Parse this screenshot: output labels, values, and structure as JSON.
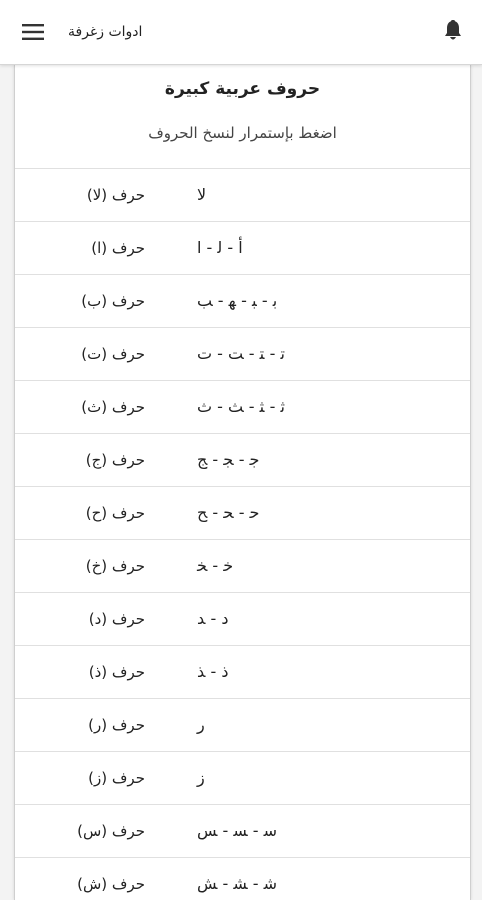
{
  "appbar": {
    "title": "ادوات زغرفة",
    "menu_icon": "hamburger-menu-icon",
    "bell_icon": "bell-icon"
  },
  "card": {
    "title": "حروف عربية كبيرة",
    "hint": "اضغط بإستمرار لنسخ الحروف"
  },
  "letters": [
    {
      "label": "حرف (لا)",
      "forms": "ﻻ"
    },
    {
      "label": "حرف (ا)",
      "forms": "ﺃ - ﻟ - ا"
    },
    {
      "label": "حرف (ب)",
      "forms": "ﺑ - ﺒ - ﮭ - ﺐ"
    },
    {
      "label": "حرف (ت)",
      "forms": "ﺗ - ﺘ - ﺖ - ﺕ"
    },
    {
      "label": "حرف (ث)",
      "forms": "ﺛ - ﺜ - ﺚ - ﺙ"
    },
    {
      "label": "حرف (ج)",
      "forms": "ﺟ - ﺠ - ﺞ"
    },
    {
      "label": "حرف (ح)",
      "forms": "ﺣ - ﺤ - ﺢ"
    },
    {
      "label": "حرف (خ)",
      "forms": "ﺧ - ﺨ"
    },
    {
      "label": "حرف (د)",
      "forms": "ﺩ - ﺪ"
    },
    {
      "label": "حرف (ذ)",
      "forms": "ﺫ - ﺬ"
    },
    {
      "label": "حرف (ر)",
      "forms": "ﺭ"
    },
    {
      "label": "حرف (ز)",
      "forms": "ﺯ"
    },
    {
      "label": "حرف (س)",
      "forms": "ﺳ - ﺴ - ﺲ"
    },
    {
      "label": "حرف (ش)",
      "forms": "ﺷ - ﺸ - ﺶ"
    }
  ],
  "colors": {
    "appbar_bg": "#ffffff",
    "page_bg": "#f3f3f3",
    "card_bg": "#ffffff",
    "divider": "#e0e0e0",
    "text": "#222222"
  }
}
